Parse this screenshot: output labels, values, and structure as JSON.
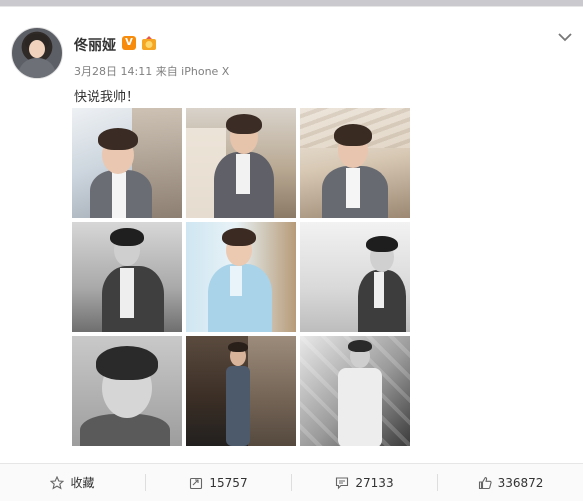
{
  "post": {
    "username": "佟丽娅",
    "vip_badge": "V",
    "meta": "3月28日 14:11 来自 iPhone X",
    "text": "快说我帅！"
  },
  "photos": [
    {
      "alt": "photo-1"
    },
    {
      "alt": "photo-2"
    },
    {
      "alt": "photo-3"
    },
    {
      "alt": "photo-4"
    },
    {
      "alt": "photo-5"
    },
    {
      "alt": "photo-6"
    },
    {
      "alt": "photo-7"
    },
    {
      "alt": "photo-8"
    },
    {
      "alt": "photo-9"
    }
  ],
  "actions": {
    "favorite": "收藏",
    "repost_count": "15757",
    "comment_count": "27133",
    "like_count": "336872"
  },
  "icons": {
    "more": "chevron-down-icon",
    "favorite": "star-icon",
    "repost": "repost-icon",
    "comment": "comment-icon",
    "like": "thumbs-up-icon",
    "medal": "medal-icon"
  },
  "colors": {
    "vip_badge": "#f78c0c",
    "page_bg": "#d8d8dc",
    "card_bg": "#ffffff"
  }
}
